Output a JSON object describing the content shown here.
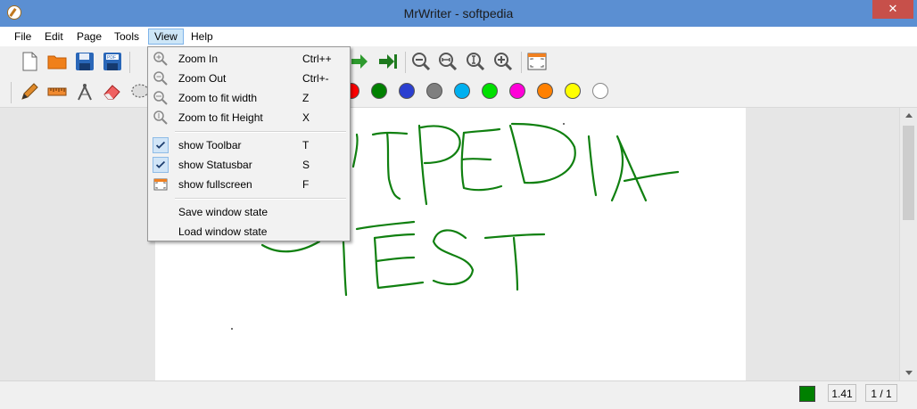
{
  "window": {
    "title": "MrWriter - softpedia",
    "close_glyph": "✕"
  },
  "menubar": {
    "items": [
      {
        "label": "File"
      },
      {
        "label": "Edit"
      },
      {
        "label": "Page"
      },
      {
        "label": "Tools"
      },
      {
        "label": "View"
      },
      {
        "label": "Help"
      }
    ]
  },
  "view_menu": {
    "items": [
      {
        "label": "Zoom In",
        "shortcut": "Ctrl++",
        "icon": "zoom-in-icon"
      },
      {
        "label": "Zoom Out",
        "shortcut": "Ctrl+-",
        "icon": "zoom-out-icon"
      },
      {
        "label": "Zoom to fit width",
        "shortcut": "Z",
        "icon": "zoom-fit-width-icon"
      },
      {
        "label": "Zoom to fit Height",
        "shortcut": "X",
        "icon": "zoom-fit-height-icon"
      },
      {
        "label": "show Toolbar",
        "shortcut": "T",
        "checked": true
      },
      {
        "label": "show Statusbar",
        "shortcut": "S",
        "checked": true
      },
      {
        "label": "show fullscreen",
        "shortcut": "F",
        "icon": "fullscreen-icon"
      },
      {
        "label": "Save window state",
        "shortcut": ""
      },
      {
        "label": "Load window state",
        "shortcut": ""
      }
    ]
  },
  "palette": {
    "colors": [
      "#ff0000",
      "#008000",
      "#2b3fd0",
      "#7f7f7f",
      "#00b0f0",
      "#00e000",
      "#ff00d8",
      "#ff8000",
      "#ffff00",
      "#ffffff"
    ],
    "selected": "#008000"
  },
  "statusbar": {
    "zoom": "1.41",
    "page": "1 / 1",
    "current_color": "#008000"
  }
}
